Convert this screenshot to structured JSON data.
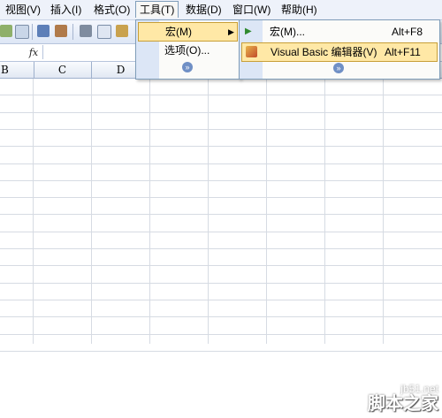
{
  "menubar": {
    "items": [
      {
        "label": "视图(V)"
      },
      {
        "label": "插入(I)"
      },
      {
        "label": "格式(O)"
      },
      {
        "label": "工具(T)"
      },
      {
        "label": "数据(D)"
      },
      {
        "label": "窗口(W)"
      },
      {
        "label": "帮助(H)"
      }
    ]
  },
  "formula_bar": {
    "fx_label": "fx"
  },
  "columns": [
    "B",
    "C",
    "D"
  ],
  "tools_menu": {
    "items": [
      {
        "label": "宏(M)",
        "submenu_arrow": "▶"
      },
      {
        "label": "选项(O)..."
      }
    ],
    "expand_label": "»"
  },
  "macro_submenu": {
    "items": [
      {
        "label": "宏(M)...",
        "shortcut": "Alt+F8"
      },
      {
        "label": "Visual Basic 编辑器(V)",
        "shortcut": "Alt+F11"
      }
    ],
    "expand_label": "»"
  },
  "watermark": {
    "line1": "jb51.net",
    "line2": "脚本之家"
  },
  "colors": {
    "highlight": "#ffe8a6",
    "menu_rail": "#dce6f6",
    "menubar": "#eef2fa"
  }
}
